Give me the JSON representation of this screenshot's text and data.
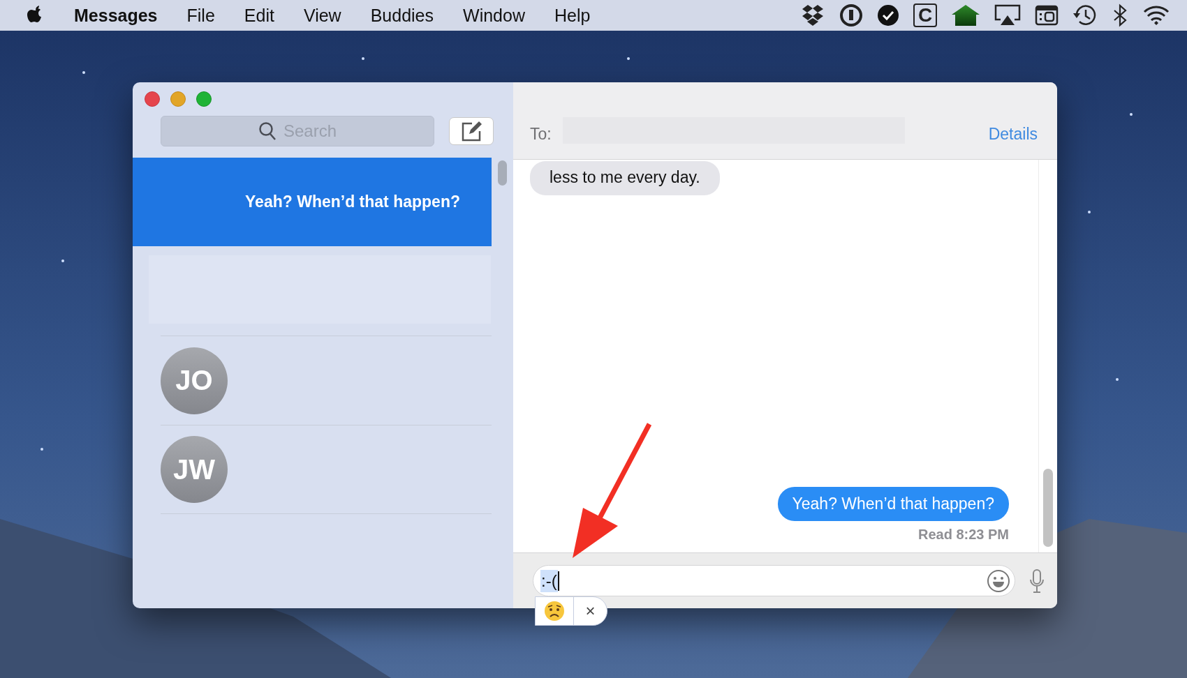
{
  "menu_bar": {
    "app_name": "Messages",
    "menus": [
      "File",
      "Edit",
      "View",
      "Buddies",
      "Window",
      "Help"
    ],
    "status_items": [
      {
        "kind": "boxes"
      },
      {
        "kind": "keyhole"
      },
      {
        "kind": "check"
      },
      {
        "kind": "letter",
        "text": "C"
      },
      {
        "kind": "house"
      },
      {
        "kind": "airplay"
      },
      {
        "kind": "window"
      },
      {
        "kind": "history"
      },
      {
        "kind": "bluetooth"
      },
      {
        "kind": "wifi"
      }
    ]
  },
  "sidebar": {
    "search": {
      "placeholder": "Search"
    },
    "conversations": [
      {
        "kind": "preview",
        "preview": "Yeah? When’d that happen?",
        "selected": true
      },
      {
        "kind": "blank",
        "selected": false
      },
      {
        "kind": "avatar",
        "initials": "JO",
        "selected": false
      },
      {
        "kind": "avatar",
        "initials": "JW",
        "selected": false
      }
    ]
  },
  "conversation": {
    "to_label": "To:",
    "details_link": "Details",
    "messages": [
      {
        "kind": "received",
        "text": "less to me every day."
      },
      {
        "kind": "sent",
        "text": "Yeah? When’d that happen?"
      }
    ],
    "read_receipt": "Read 8:23 PM",
    "input": {
      "value": ":-("
    },
    "suggestion": {
      "dismiss": "×"
    }
  }
}
